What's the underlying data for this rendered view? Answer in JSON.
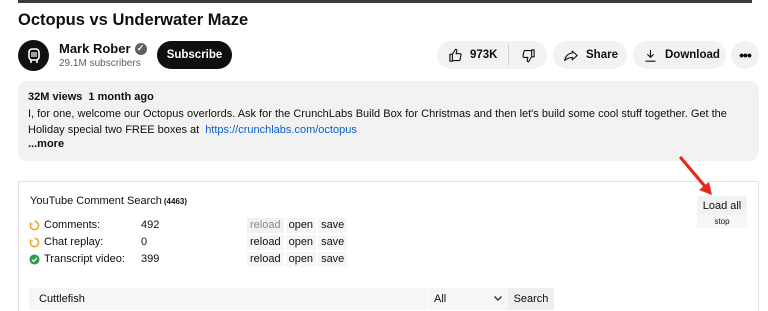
{
  "video": {
    "title": "Octopus vs Underwater Maze"
  },
  "channel": {
    "name": "Mark Rober",
    "subscribers": "29.1M subscribers",
    "subscribe_label": "Subscribe"
  },
  "actions": {
    "likes": "973K",
    "share_label": "Share",
    "download_label": "Download",
    "more_label": "•••"
  },
  "description": {
    "views": "32M views",
    "age": "1 month ago",
    "text": "I, for one, welcome our Octopus overlords. Ask for the CrunchLabs Build Box for Christmas and then let's build some cool stuff together. Get the Holiday special two FREE boxes at",
    "link": "https://crunchlabs.com/octopus",
    "more_label": "...more"
  },
  "extension": {
    "title": "YouTube Comment Search",
    "count": "(4463)",
    "rows": [
      {
        "label": "Comments:",
        "value": "492",
        "icon": "loading-circle-icon",
        "status_color": "#f0a020"
      },
      {
        "label": "Chat replay:",
        "value": "0",
        "icon": "loading-circle-icon",
        "status_color": "#f0a020"
      },
      {
        "label": "Transcript video:",
        "value": "399",
        "icon": "check-circle-icon",
        "status_color": "#2e9d4a"
      }
    ],
    "row_actions": {
      "reload": "reload",
      "open": "open",
      "save": "save"
    },
    "load_all_label": "Load all",
    "stop_label": "stop",
    "search": {
      "value": "Cuttlefish",
      "filter": "All",
      "button_label": "Search"
    }
  },
  "colors": {
    "accent_link": "#065fd4",
    "annotation_arrow": "#e8271f",
    "subscribe_bg": "#0f0f0f"
  }
}
